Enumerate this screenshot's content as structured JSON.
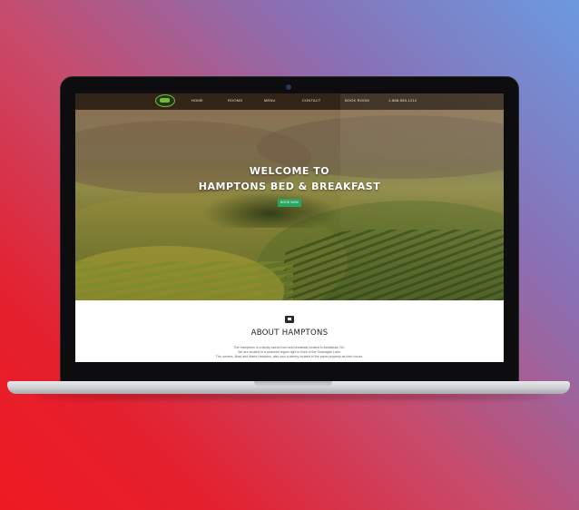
{
  "nav": {
    "items": [
      "HOME",
      "ROOMS",
      "MENU",
      "CONTACT",
      "BOOK ROOM",
      "1-888-555-1212"
    ]
  },
  "hero": {
    "title_line1": "WELCOME TO",
    "title_line2": "HAMPTONS BED & BREAKFAST",
    "button_label": "BOOK NOW"
  },
  "about": {
    "title": "ABOUT HAMPTONS",
    "lines": [
      "The Hamptons is a family owned bed and breakfast located in Ashtabula, NC.",
      "We are located in a peaceful region right in front of the Okanagan Lake.",
      "The owners, Brad and Marla Hampton, also own a winery located in the same property as their house."
    ]
  },
  "colors": {
    "accent_button": "#27a561",
    "logo_green": "#7bb73a"
  },
  "icons": [
    "logo-icon",
    "camera-icon",
    "about-icon"
  ]
}
